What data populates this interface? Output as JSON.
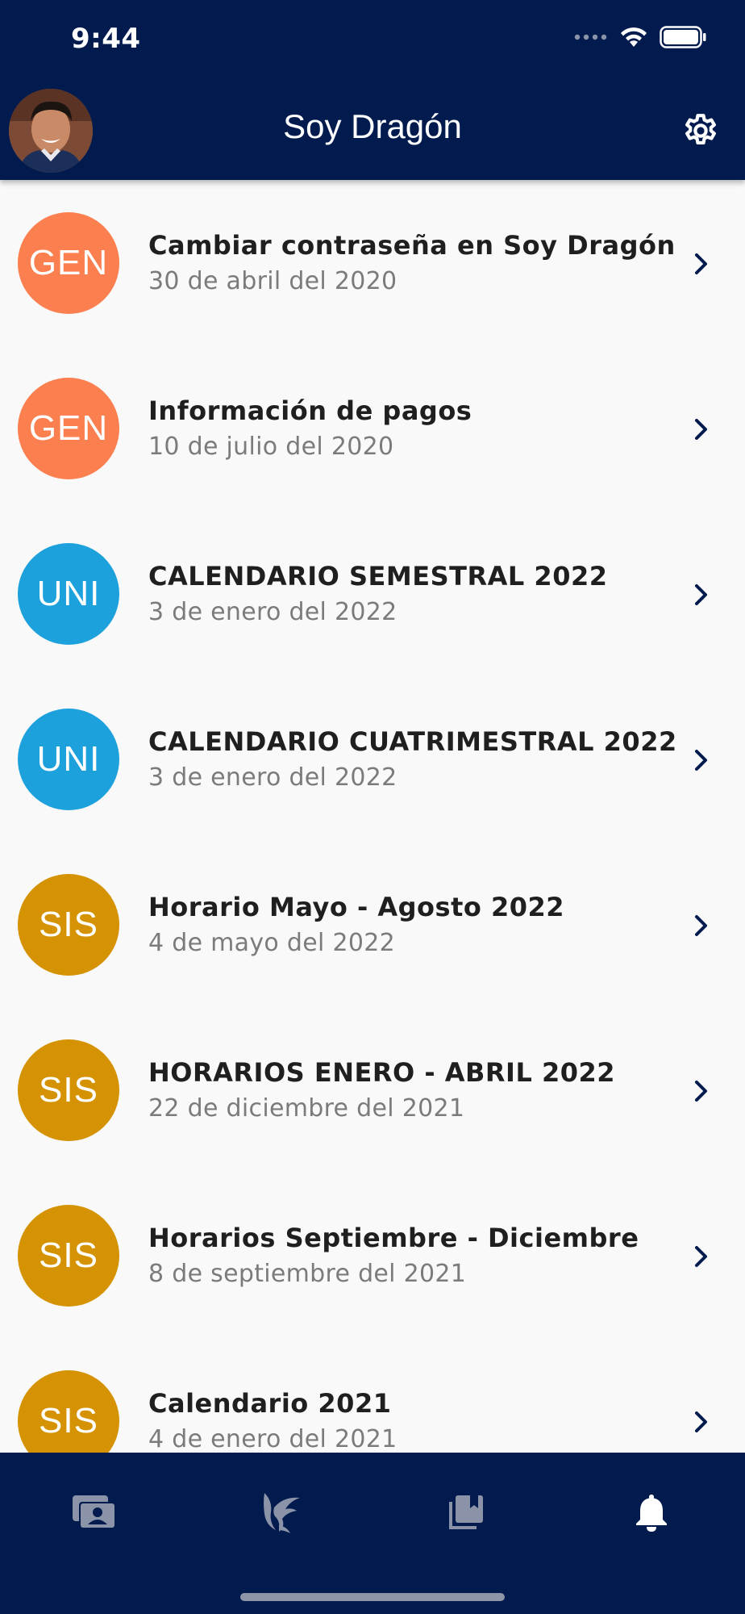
{
  "status_bar": {
    "time": "9:44",
    "icons": [
      "signal-dots-icon",
      "wifi-icon",
      "battery-icon"
    ]
  },
  "header": {
    "title": "Soy Dragón",
    "avatar": "user-avatar",
    "settings_icon": "gear-icon"
  },
  "notifications": [
    {
      "badge": "GEN",
      "badge_color": "#fc7f4f",
      "title": "Cambiar contraseña en Soy Dragón",
      "date": "30 de abril del 2020"
    },
    {
      "badge": "GEN",
      "badge_color": "#fc7f4f",
      "title": "Información de pagos",
      "date": "10 de julio del 2020"
    },
    {
      "badge": "UNI",
      "badge_color": "#1da1dd",
      "title": "CALENDARIO SEMESTRAL 2022",
      "date": "3 de enero del 2022"
    },
    {
      "badge": "UNI",
      "badge_color": "#1da1dd",
      "title": "CALENDARIO CUATRIMESTRAL 2022",
      "date": "3 de enero del 2022"
    },
    {
      "badge": "SIS",
      "badge_color": "#d59303",
      "title": "Horario Mayo - Agosto 2022",
      "date": "4 de mayo del 2022"
    },
    {
      "badge": "SIS",
      "badge_color": "#d59303",
      "title": "HORARIOS ENERO - ABRIL 2022",
      "date": "22 de diciembre del 2021"
    },
    {
      "badge": "SIS",
      "badge_color": "#d59303",
      "title": "Horarios Septiembre - Diciembre",
      "date": "8 de septiembre del 2021"
    },
    {
      "badge": "SIS",
      "badge_color": "#d59303",
      "title": "Calendario 2021",
      "date": "4 de enero del 2021"
    }
  ],
  "bottom_nav": {
    "items": [
      {
        "icon": "id-card-icon",
        "active": false
      },
      {
        "icon": "dragon-logo-icon",
        "active": false
      },
      {
        "icon": "library-books-icon",
        "active": false
      },
      {
        "icon": "bell-icon",
        "active": true
      }
    ],
    "active_color": "#ffffff",
    "inactive_color": "#8b93a8"
  },
  "colors": {
    "brand_navy": "#021b4f",
    "background": "#f9f9f9",
    "gen": "#fc7f4f",
    "uni": "#1da1dd",
    "sis": "#d59303"
  }
}
